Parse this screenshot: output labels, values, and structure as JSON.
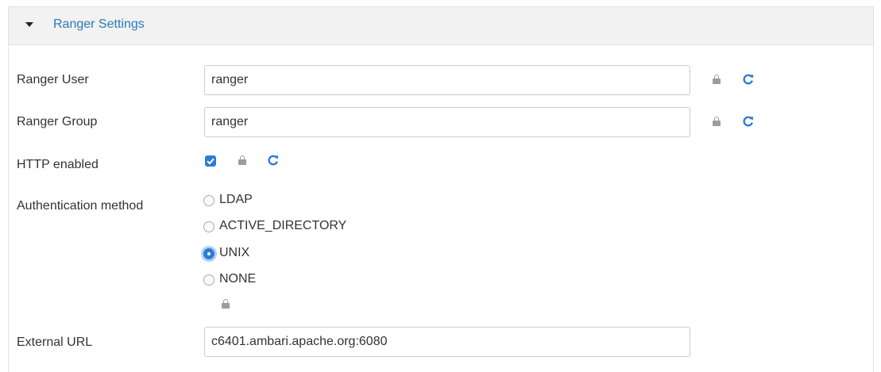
{
  "section": {
    "title": "Ranger Settings"
  },
  "fields": {
    "ranger_user": {
      "label": "Ranger User",
      "value": "ranger"
    },
    "ranger_group": {
      "label": "Ranger Group",
      "value": "ranger"
    },
    "http_enabled": {
      "label": "HTTP enabled",
      "checked": true
    },
    "auth_method": {
      "label": "Authentication method",
      "options": [
        "LDAP",
        "ACTIVE_DIRECTORY",
        "UNIX",
        "NONE"
      ],
      "selected": "UNIX"
    },
    "external_url": {
      "label": "External URL",
      "value": "c6401.ambari.apache.org:6080"
    }
  },
  "icons": {
    "lock": "lock-icon",
    "refresh": "refresh-icon",
    "caret": "caret-down-icon"
  },
  "colors": {
    "accent": "#2d7dd2",
    "title": "#2a7ab8",
    "header_bg": "#f2f2f2",
    "lock": "#9c9c9c"
  }
}
